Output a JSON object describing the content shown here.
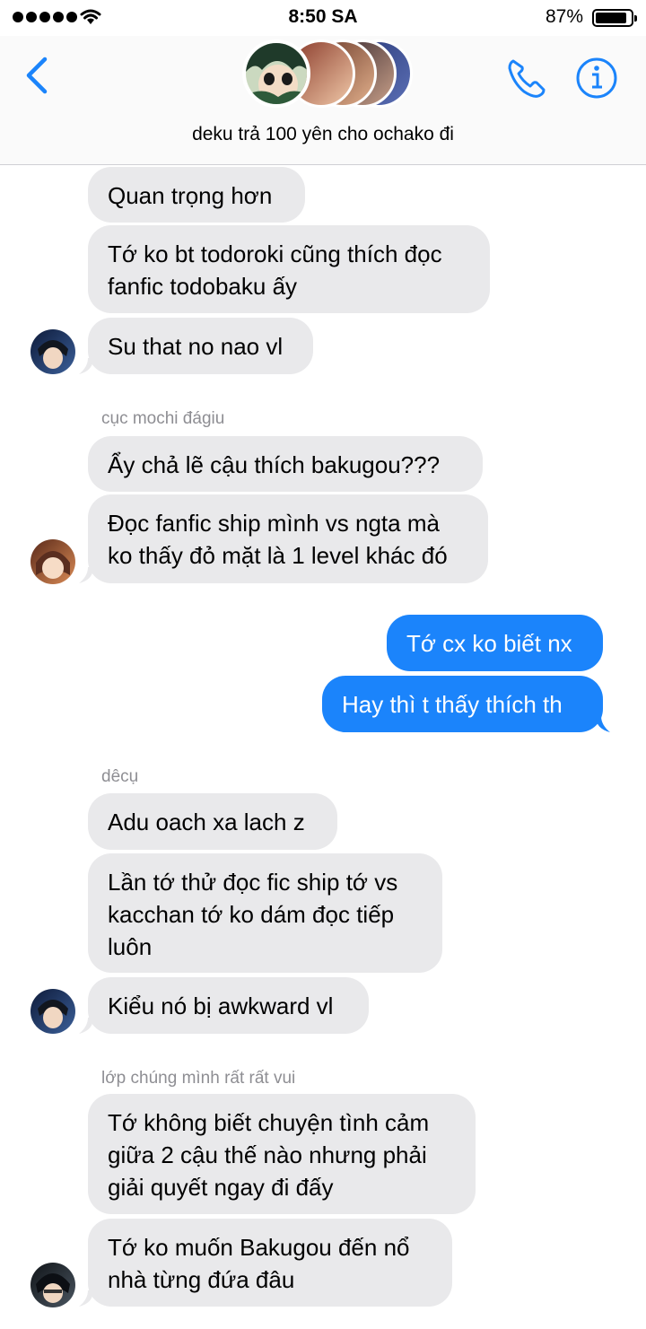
{
  "status_bar": {
    "time": "8:50 SA",
    "battery_percent": "87%",
    "battery_level": 0.87
  },
  "header": {
    "title": "deku trả 100 yên cho ochako đi",
    "back_icon": "chevron-left-icon",
    "call_icon": "phone-icon",
    "info_icon": "info-icon"
  },
  "messages": [
    {
      "text": "Quan trọng hơn"
    },
    {
      "text": "Tớ ko bt todoroki cũng thích đọc\nfanfic todobaku ấy"
    },
    {
      "text": "Su that no nao vl"
    },
    {
      "sender": "cục mochi đágiu",
      "text": "Ẩy chả lẽ cậu thích bakugou???"
    },
    {
      "text": "Đọc fanfic ship mình vs ngta mà\nko thấy đỏ mặt là 1 level khác đó"
    },
    {
      "text": "Tớ cx ko biết nx"
    },
    {
      "text": "Hay thì t thấy thích th"
    },
    {
      "sender": "dêcụ",
      "text": "Adu oach xa lach z"
    },
    {
      "text": "Lần tớ thử đọc fic ship tớ vs\nkacchan tớ ko dám đọc tiếp\nluôn"
    },
    {
      "text": "Kiểu nó bị awkward vl"
    },
    {
      "sender": "lớp chúng mình rất rất vui",
      "text": "Tớ không biết chuyện tình cảm\ngiữa 2 cậu thế nào nhưng phải\ngiải quyết ngay đi đấy"
    },
    {
      "text": "Tớ ko muốn Bakugou đến nổ\nnhà từng đứa đâu"
    }
  ],
  "colors": {
    "accent": "#1b84fb",
    "incoming_bubble": "#e9e9eb",
    "sender_gray": "#8e8e93"
  }
}
